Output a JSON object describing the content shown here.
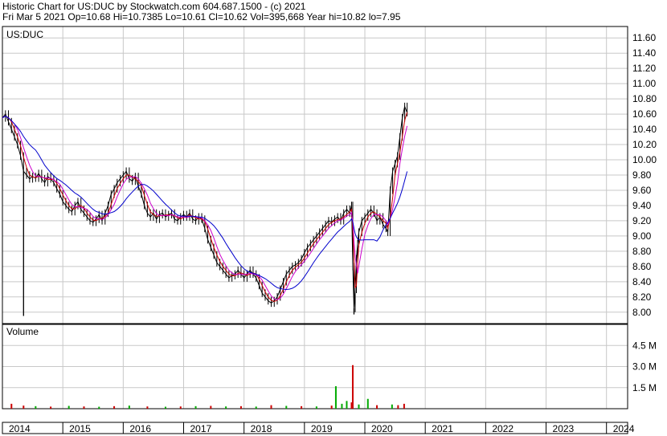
{
  "header": {
    "line1": "Historic Chart for US:DUC by Stockwatch.com 604.687.1500 - (c) 2021",
    "line2": "Fri Mar  5 2021   Op=10.68  Hi=10.7385  Lo=10.61  Cl=10.62  Vol=395,668  Year hi=10.82  lo=7.95"
  },
  "chart_data": {
    "type": "line",
    "symbol_label": "US:DUC",
    "volume_label": "Volume",
    "price_ticks": [
      "8.00",
      "8.20",
      "8.40",
      "8.60",
      "8.80",
      "9.00",
      "9.20",
      "9.40",
      "9.60",
      "9.80",
      "10.00",
      "10.20",
      "10.40",
      "10.60",
      "10.80",
      "11.00",
      "11.20",
      "11.40",
      "11.60"
    ],
    "price_ylim": [
      7.85,
      11.75
    ],
    "volume_ticks": [
      "1.5 M",
      "3.0 M",
      "4.5 M"
    ],
    "volume_tick_values": [
      1.5,
      3.0,
      4.5
    ],
    "volume_ylim": [
      0,
      6.0
    ],
    "year_labels": [
      "2014",
      "2015",
      "2016",
      "2017",
      "2018",
      "2019",
      "2020",
      "2021",
      "2022",
      "2023",
      "2024"
    ],
    "x_range_years": [
      2014.0,
      2024.35
    ],
    "colors": {
      "price": "#000000",
      "ma_short": "#cc0000",
      "ma_mid": "#cc00cc",
      "ma_long": "#0000cc",
      "vol_up": "#00aa00",
      "vol_down": "#cc0000",
      "grid": "#c8c8c8"
    },
    "price_series": [
      {
        "x": 2014.0,
        "c": 10.55
      },
      {
        "x": 2014.05,
        "c": 10.6
      },
      {
        "x": 2014.1,
        "c": 10.5
      },
      {
        "x": 2014.15,
        "c": 10.4
      },
      {
        "x": 2014.2,
        "c": 10.3
      },
      {
        "x": 2014.25,
        "c": 10.2
      },
      {
        "x": 2014.3,
        "c": 10.05
      },
      {
        "x": 2014.35,
        "c": 9.85
      },
      {
        "x": 2014.4,
        "c": 9.8
      },
      {
        "x": 2014.45,
        "c": 9.75
      },
      {
        "x": 2014.5,
        "c": 9.78
      },
      {
        "x": 2014.55,
        "c": 9.76
      },
      {
        "x": 2014.6,
        "c": 9.82
      },
      {
        "x": 2014.65,
        "c": 9.75
      },
      {
        "x": 2014.7,
        "c": 9.7
      },
      {
        "x": 2014.75,
        "c": 9.78
      },
      {
        "x": 2014.8,
        "c": 9.75
      },
      {
        "x": 2014.85,
        "c": 9.7
      },
      {
        "x": 2014.9,
        "c": 9.62
      },
      {
        "x": 2014.95,
        "c": 9.55
      },
      {
        "x": 2015.0,
        "c": 9.45
      },
      {
        "x": 2015.05,
        "c": 9.4
      },
      {
        "x": 2015.1,
        "c": 9.35
      },
      {
        "x": 2015.15,
        "c": 9.32
      },
      {
        "x": 2015.2,
        "c": 9.4
      },
      {
        "x": 2015.25,
        "c": 9.45
      },
      {
        "x": 2015.3,
        "c": 9.35
      },
      {
        "x": 2015.35,
        "c": 9.3
      },
      {
        "x": 2015.4,
        "c": 9.25
      },
      {
        "x": 2015.45,
        "c": 9.2
      },
      {
        "x": 2015.5,
        "c": 9.18
      },
      {
        "x": 2015.55,
        "c": 9.22
      },
      {
        "x": 2015.6,
        "c": 9.28
      },
      {
        "x": 2015.65,
        "c": 9.2
      },
      {
        "x": 2015.7,
        "c": 9.3
      },
      {
        "x": 2015.75,
        "c": 9.4
      },
      {
        "x": 2015.8,
        "c": 9.55
      },
      {
        "x": 2015.85,
        "c": 9.62
      },
      {
        "x": 2015.9,
        "c": 9.7
      },
      {
        "x": 2015.95,
        "c": 9.75
      },
      {
        "x": 2016.0,
        "c": 9.8
      },
      {
        "x": 2016.05,
        "c": 9.85
      },
      {
        "x": 2016.1,
        "c": 9.75
      },
      {
        "x": 2016.15,
        "c": 9.72
      },
      {
        "x": 2016.2,
        "c": 9.78
      },
      {
        "x": 2016.25,
        "c": 9.65
      },
      {
        "x": 2016.3,
        "c": 9.55
      },
      {
        "x": 2016.35,
        "c": 9.4
      },
      {
        "x": 2016.4,
        "c": 9.3
      },
      {
        "x": 2016.45,
        "c": 9.25
      },
      {
        "x": 2016.5,
        "c": 9.3
      },
      {
        "x": 2016.55,
        "c": 9.22
      },
      {
        "x": 2016.6,
        "c": 9.28
      },
      {
        "x": 2016.65,
        "c": 9.3
      },
      {
        "x": 2016.7,
        "c": 9.25
      },
      {
        "x": 2016.75,
        "c": 9.28
      },
      {
        "x": 2016.8,
        "c": 9.3
      },
      {
        "x": 2016.85,
        "c": 9.22
      },
      {
        "x": 2016.9,
        "c": 9.2
      },
      {
        "x": 2016.95,
        "c": 9.25
      },
      {
        "x": 2017.0,
        "c": 9.28
      },
      {
        "x": 2017.05,
        "c": 9.25
      },
      {
        "x": 2017.1,
        "c": 9.3
      },
      {
        "x": 2017.15,
        "c": 9.22
      },
      {
        "x": 2017.2,
        "c": 9.2
      },
      {
        "x": 2017.25,
        "c": 9.25
      },
      {
        "x": 2017.3,
        "c": 9.22
      },
      {
        "x": 2017.35,
        "c": 9.1
      },
      {
        "x": 2017.4,
        "c": 8.95
      },
      {
        "x": 2017.45,
        "c": 8.85
      },
      {
        "x": 2017.5,
        "c": 8.75
      },
      {
        "x": 2017.55,
        "c": 8.65
      },
      {
        "x": 2017.6,
        "c": 8.6
      },
      {
        "x": 2017.65,
        "c": 8.55
      },
      {
        "x": 2017.7,
        "c": 8.5
      },
      {
        "x": 2017.75,
        "c": 8.45
      },
      {
        "x": 2017.8,
        "c": 8.48
      },
      {
        "x": 2017.85,
        "c": 8.5
      },
      {
        "x": 2017.9,
        "c": 8.55
      },
      {
        "x": 2017.95,
        "c": 8.5
      },
      {
        "x": 2018.0,
        "c": 8.45
      },
      {
        "x": 2018.05,
        "c": 8.5
      },
      {
        "x": 2018.1,
        "c": 8.55
      },
      {
        "x": 2018.15,
        "c": 8.5
      },
      {
        "x": 2018.2,
        "c": 8.45
      },
      {
        "x": 2018.25,
        "c": 8.35
      },
      {
        "x": 2018.3,
        "c": 8.25
      },
      {
        "x": 2018.35,
        "c": 8.2
      },
      {
        "x": 2018.4,
        "c": 8.15
      },
      {
        "x": 2018.45,
        "c": 8.12
      },
      {
        "x": 2018.5,
        "c": 8.15
      },
      {
        "x": 2018.55,
        "c": 8.2
      },
      {
        "x": 2018.6,
        "c": 8.3
      },
      {
        "x": 2018.65,
        "c": 8.4
      },
      {
        "x": 2018.7,
        "c": 8.5
      },
      {
        "x": 2018.75,
        "c": 8.55
      },
      {
        "x": 2018.8,
        "c": 8.6
      },
      {
        "x": 2018.85,
        "c": 8.62
      },
      {
        "x": 2018.9,
        "c": 8.65
      },
      {
        "x": 2018.95,
        "c": 8.7
      },
      {
        "x": 2019.0,
        "c": 8.78
      },
      {
        "x": 2019.05,
        "c": 8.85
      },
      {
        "x": 2019.1,
        "c": 8.9
      },
      {
        "x": 2019.15,
        "c": 8.95
      },
      {
        "x": 2019.2,
        "c": 9.0
      },
      {
        "x": 2019.25,
        "c": 9.05
      },
      {
        "x": 2019.3,
        "c": 9.1
      },
      {
        "x": 2019.35,
        "c": 9.15
      },
      {
        "x": 2019.4,
        "c": 9.2
      },
      {
        "x": 2019.45,
        "c": 9.18
      },
      {
        "x": 2019.5,
        "c": 9.22
      },
      {
        "x": 2019.55,
        "c": 9.25
      },
      {
        "x": 2019.6,
        "c": 9.2
      },
      {
        "x": 2019.65,
        "c": 9.3
      },
      {
        "x": 2019.7,
        "c": 9.35
      },
      {
        "x": 2019.75,
        "c": 9.3
      },
      {
        "x": 2019.78,
        "c": 9.4
      },
      {
        "x": 2019.8,
        "c": 8.6
      },
      {
        "x": 2019.82,
        "c": 8.05
      },
      {
        "x": 2019.84,
        "c": 8.3
      },
      {
        "x": 2019.86,
        "c": 8.7
      },
      {
        "x": 2019.88,
        "c": 8.9
      },
      {
        "x": 2019.9,
        "c": 9.05
      },
      {
        "x": 2019.95,
        "c": 9.2
      },
      {
        "x": 2020.0,
        "c": 9.25
      },
      {
        "x": 2020.05,
        "c": 9.3
      },
      {
        "x": 2020.1,
        "c": 9.35
      },
      {
        "x": 2020.15,
        "c": 9.3
      },
      {
        "x": 2020.2,
        "c": 9.2
      },
      {
        "x": 2020.25,
        "c": 9.25
      },
      {
        "x": 2020.3,
        "c": 9.15
      },
      {
        "x": 2020.35,
        "c": 9.1
      },
      {
        "x": 2020.38,
        "c": 9.05
      },
      {
        "x": 2020.42,
        "c": 9.6
      },
      {
        "x": 2020.46,
        "c": 9.85
      },
      {
        "x": 2020.5,
        "c": 9.95
      },
      {
        "x": 2020.54,
        "c": 10.05
      },
      {
        "x": 2020.58,
        "c": 10.3
      },
      {
        "x": 2020.62,
        "c": 10.55
      },
      {
        "x": 2020.66,
        "c": 10.7
      },
      {
        "x": 2020.7,
        "c": 10.62
      }
    ],
    "spikes": [
      {
        "x": 2014.35,
        "low": 7.95
      },
      {
        "x": 2019.82,
        "low": 7.97
      }
    ],
    "volume_series": [
      {
        "x": 2014.15,
        "v": 0.35,
        "up": false
      },
      {
        "x": 2014.35,
        "v": 0.22,
        "up": false
      },
      {
        "x": 2014.55,
        "v": 0.18,
        "up": true
      },
      {
        "x": 2014.8,
        "v": 0.15,
        "up": false
      },
      {
        "x": 2015.1,
        "v": 0.2,
        "up": true
      },
      {
        "x": 2015.35,
        "v": 0.16,
        "up": false
      },
      {
        "x": 2015.6,
        "v": 0.14,
        "up": true
      },
      {
        "x": 2015.85,
        "v": 0.18,
        "up": false
      },
      {
        "x": 2016.1,
        "v": 0.22,
        "up": true
      },
      {
        "x": 2016.4,
        "v": 0.16,
        "up": false
      },
      {
        "x": 2016.7,
        "v": 0.14,
        "up": true
      },
      {
        "x": 2016.95,
        "v": 0.16,
        "up": false
      },
      {
        "x": 2017.2,
        "v": 0.18,
        "up": true
      },
      {
        "x": 2017.45,
        "v": 0.2,
        "up": false
      },
      {
        "x": 2017.7,
        "v": 0.16,
        "up": true
      },
      {
        "x": 2017.95,
        "v": 0.18,
        "up": false
      },
      {
        "x": 2018.2,
        "v": 0.15,
        "up": true
      },
      {
        "x": 2018.45,
        "v": 0.25,
        "up": false
      },
      {
        "x": 2018.7,
        "v": 0.2,
        "up": true
      },
      {
        "x": 2018.95,
        "v": 0.18,
        "up": false
      },
      {
        "x": 2019.2,
        "v": 0.16,
        "up": true
      },
      {
        "x": 2019.45,
        "v": 0.22,
        "up": false
      },
      {
        "x": 2019.52,
        "v": 1.6,
        "up": true
      },
      {
        "x": 2019.62,
        "v": 0.35,
        "up": true
      },
      {
        "x": 2019.7,
        "v": 0.55,
        "up": true
      },
      {
        "x": 2019.78,
        "v": 0.45,
        "up": false
      },
      {
        "x": 2019.8,
        "v": 3.1,
        "up": false
      },
      {
        "x": 2019.9,
        "v": 0.3,
        "up": true
      },
      {
        "x": 2020.05,
        "v": 0.7,
        "up": true
      },
      {
        "x": 2020.2,
        "v": 0.25,
        "up": false
      },
      {
        "x": 2020.45,
        "v": 0.3,
        "up": true
      },
      {
        "x": 2020.55,
        "v": 0.25,
        "up": false
      },
      {
        "x": 2020.65,
        "v": 0.35,
        "up": false
      }
    ]
  }
}
